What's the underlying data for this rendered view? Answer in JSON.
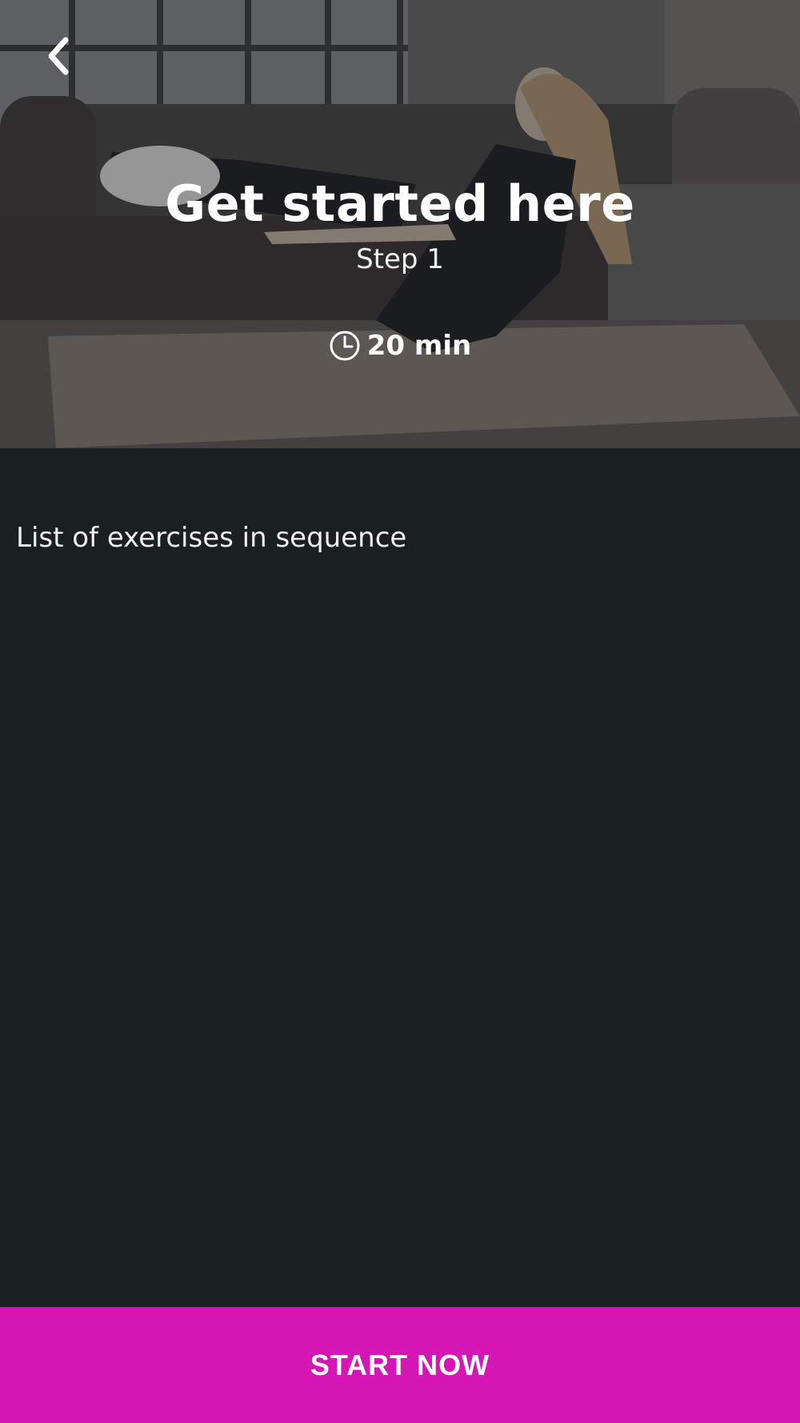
{
  "header": {
    "back_icon": "chevron-left-icon",
    "title": "Get started here",
    "subtitle": "Step 1",
    "duration_icon": "clock-icon",
    "duration": "20 min"
  },
  "content": {
    "section_heading": "List of exercises in sequence",
    "exercises": []
  },
  "footer": {
    "start_label": "START NOW"
  },
  "colors": {
    "background": "#1a1f21",
    "accent": "#d316b4",
    "text": "#ffffff"
  }
}
